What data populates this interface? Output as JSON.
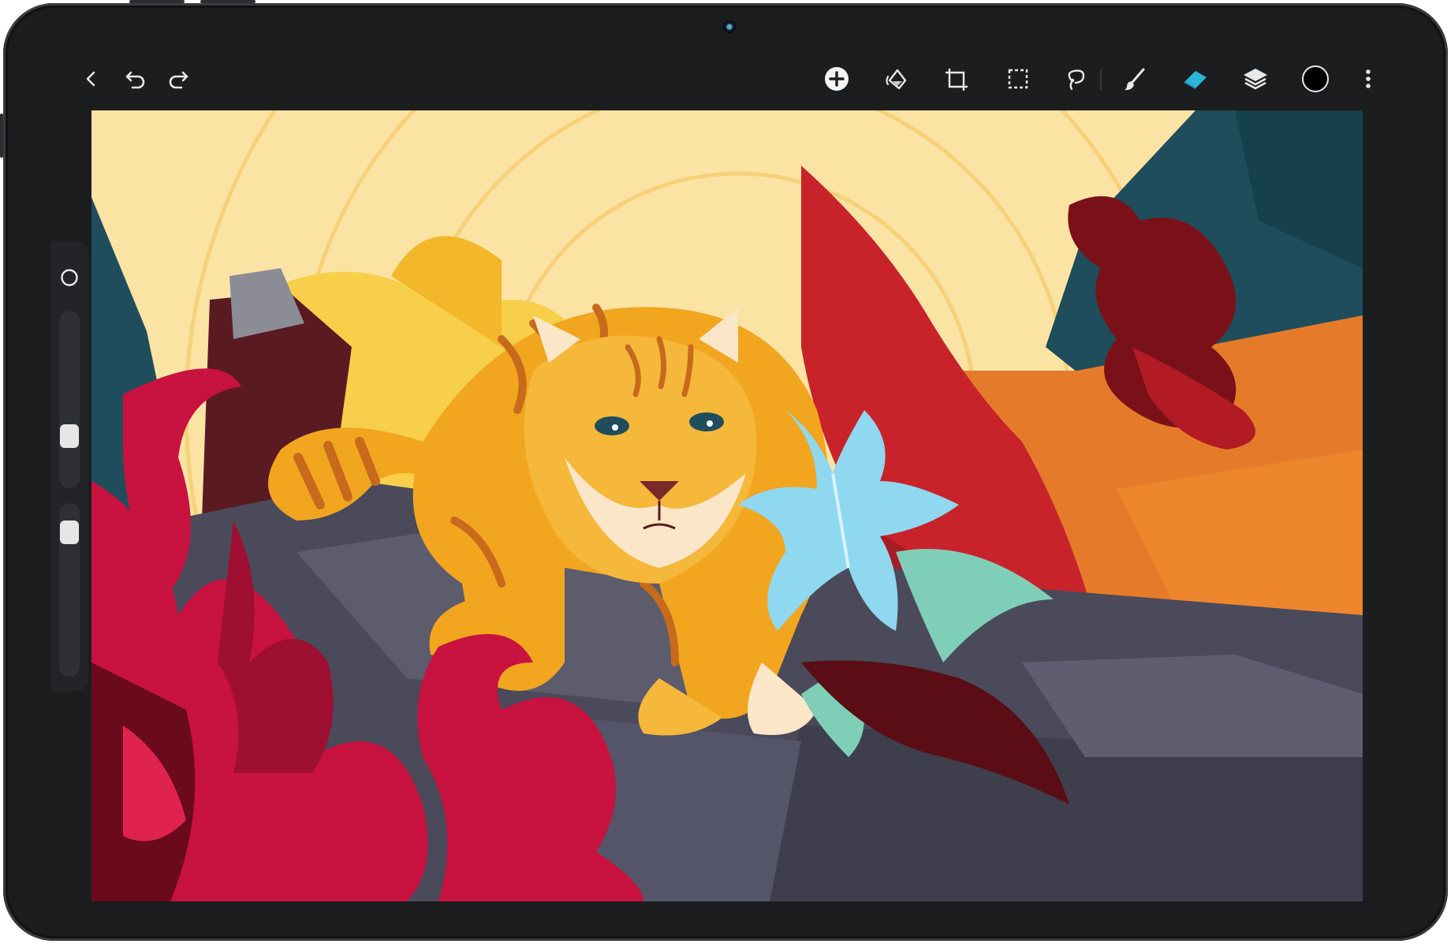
{
  "app": {
    "accent": "#2bb6d6",
    "toolbar_bg": "#1c1d1f",
    "bezel": "#1b1c1e"
  },
  "toolbar": {
    "left": [
      {
        "icon": "chevron-left-icon",
        "action": "back"
      },
      {
        "icon": "undo-icon",
        "action": "undo"
      },
      {
        "icon": "redo-icon",
        "action": "redo"
      }
    ],
    "right": [
      {
        "icon": "add-circle-icon",
        "action": "add"
      },
      {
        "icon": "adjustments-icon",
        "action": "adjustments"
      },
      {
        "icon": "transform-icon",
        "action": "transform"
      },
      {
        "icon": "selection-icon",
        "action": "selection"
      },
      {
        "icon": "lasso-icon",
        "action": "lasso"
      },
      {
        "icon": "brush-icon",
        "action": "brush"
      },
      {
        "icon": "eraser-icon",
        "action": "eraser",
        "active": true
      },
      {
        "icon": "layers-icon",
        "action": "layers"
      },
      {
        "icon": "color-swatch-icon",
        "action": "color",
        "color": "#000000"
      },
      {
        "icon": "more-vertical-icon",
        "action": "more"
      }
    ]
  },
  "sidebar": {
    "modify_button_icon": "circle-icon",
    "sliders": [
      {
        "name": "brush-size",
        "level": 0.35
      },
      {
        "name": "brush-opacity",
        "level": 0.95
      }
    ]
  },
  "canvas": {
    "content": "illustration-artwork",
    "palette": [
      "#fbe3a4",
      "#f2a51f",
      "#c8123f",
      "#1f4d5c",
      "#4a4a5a",
      "#8fd8ef",
      "#5a0d14"
    ]
  }
}
